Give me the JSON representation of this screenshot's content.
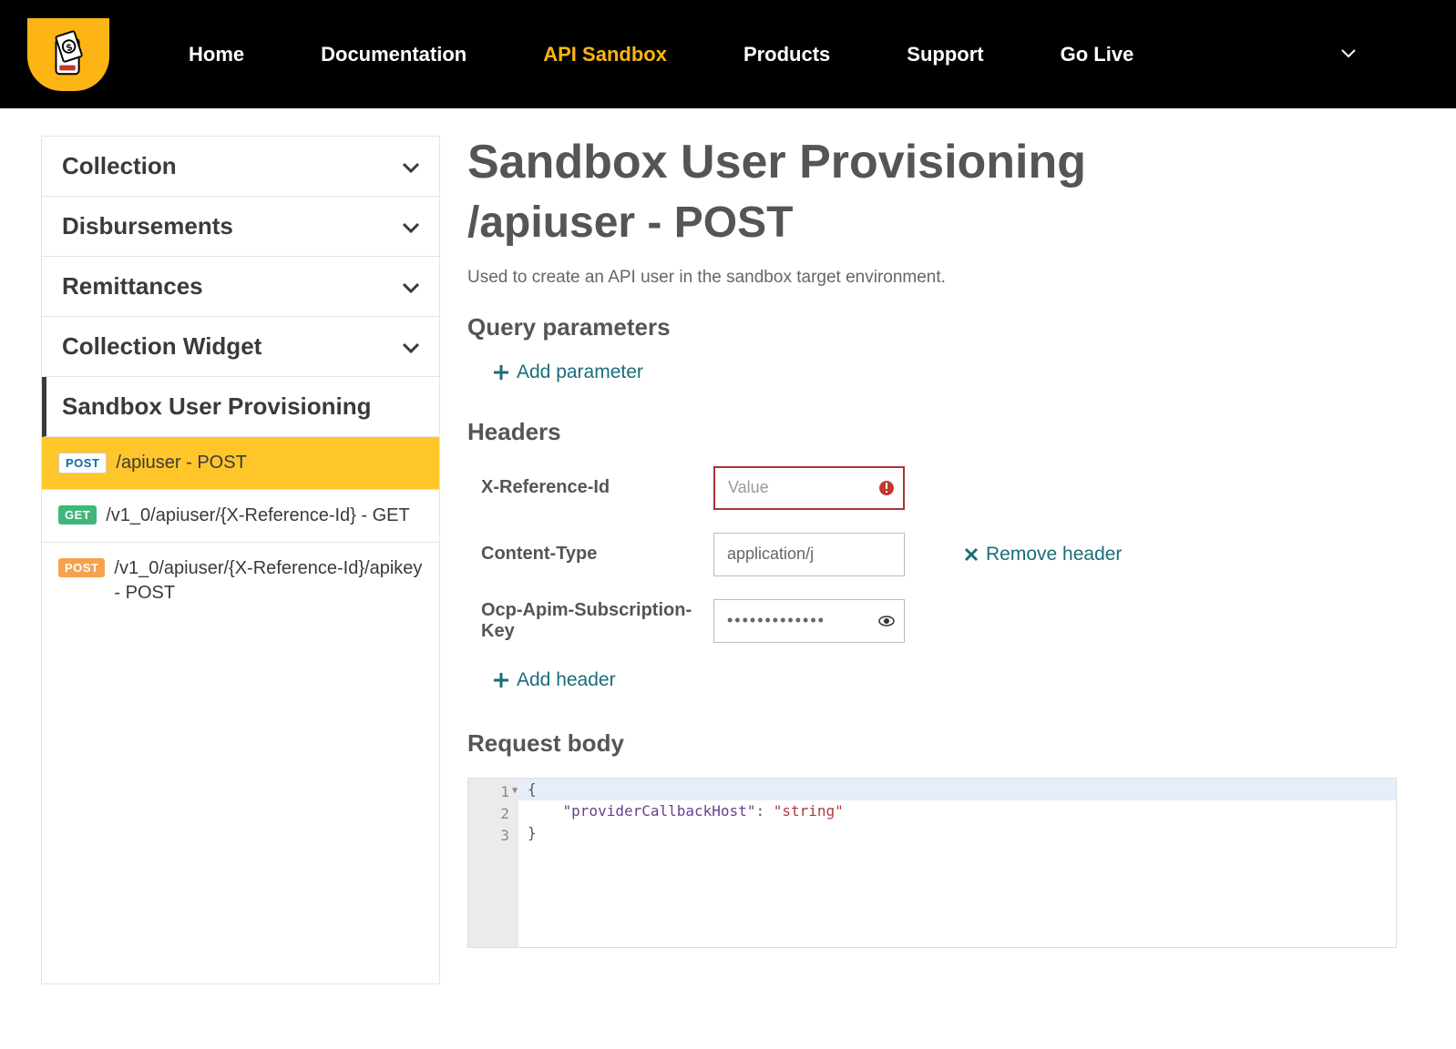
{
  "nav": {
    "items": [
      {
        "label": "Home"
      },
      {
        "label": "Documentation"
      },
      {
        "label": "API Sandbox",
        "active": true
      },
      {
        "label": "Products"
      },
      {
        "label": "Support"
      },
      {
        "label": "Go Live"
      }
    ]
  },
  "sidebar": {
    "groups": [
      {
        "label": "Collection"
      },
      {
        "label": "Disbursements"
      },
      {
        "label": "Remittances"
      },
      {
        "label": "Collection Widget"
      },
      {
        "label": "Sandbox User Provisioning",
        "active": true,
        "expanded": true
      }
    ],
    "items": [
      {
        "method": "POST",
        "badge_class": "post-blue",
        "label": "/apiuser - POST",
        "selected": true
      },
      {
        "method": "GET",
        "badge_class": "get-green",
        "label": "/v1_0/apiuser/{X-Reference-Id} - GET"
      },
      {
        "method": "POST",
        "badge_class": "post-orange",
        "label": "/v1_0/apiuser/{X-Reference-Id}/apikey - POST"
      }
    ]
  },
  "content": {
    "title": "Sandbox User Provisioning",
    "endpoint": "/apiuser - POST",
    "description": "Used to create an API user in the sandbox target environment.",
    "sections": {
      "query_params": "Query parameters",
      "headers": "Headers",
      "request_body": "Request body"
    },
    "actions": {
      "add_parameter": "Add parameter",
      "add_header": "Add header",
      "remove_header": "Remove header"
    },
    "headers": [
      {
        "name": "X-Reference-Id",
        "placeholder": "Value",
        "value": "",
        "error": true
      },
      {
        "name": "Content-Type",
        "value": "application/j",
        "removable": true
      },
      {
        "name": "Ocp-Apim-Subscription-Key",
        "value": "•••••••••••••",
        "eye": true
      }
    ],
    "request_body": {
      "lines": [
        {
          "n": 1,
          "text": "{",
          "fold": true
        },
        {
          "n": 2,
          "text": "    \"providerCallbackHost\": \"string\""
        },
        {
          "n": 3,
          "text": "}"
        }
      ]
    }
  }
}
